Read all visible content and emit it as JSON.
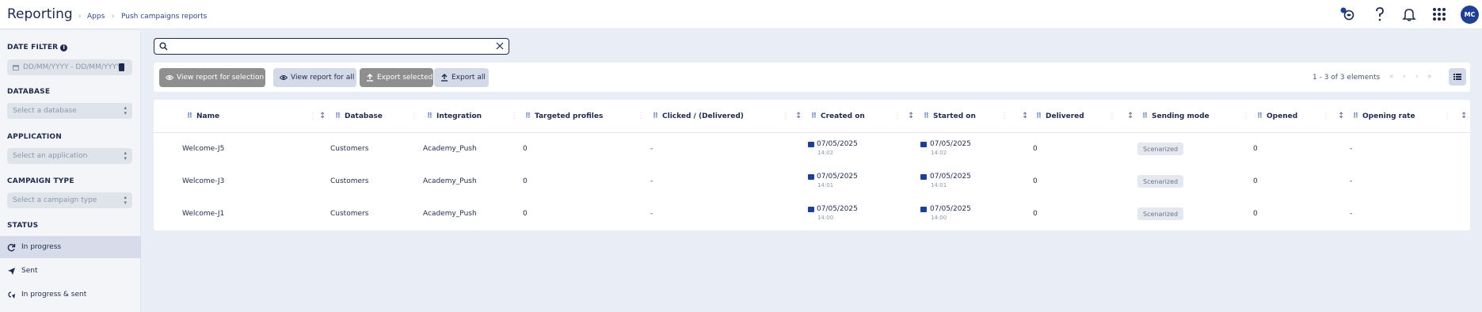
{
  "header": {
    "title": "Reporting",
    "breadcrumbs": [
      "Apps",
      "Push campaigns reports"
    ],
    "avatar_initials": "MC",
    "icons": [
      "notification-toggle-icon",
      "help-icon",
      "bell-icon",
      "apps-grid-icon"
    ]
  },
  "sidebar": {
    "date_filter_title": "DATE FILTER",
    "date_placeholder": "DD/MM/YYYY - DD/MM/YYYY",
    "database_title": "DATABASE",
    "database_placeholder": "Select a database",
    "application_title": "APPLICATION",
    "application_placeholder": "Select an application",
    "campaign_type_title": "CAMPAIGN TYPE",
    "campaign_type_placeholder": "Select a campaign type",
    "status_title": "STATUS",
    "status_items": [
      {
        "label": "In progress",
        "icon": "refresh-icon",
        "active": true
      },
      {
        "label": "Sent",
        "icon": "send-icon",
        "active": false
      },
      {
        "label": "In progress & sent",
        "icon": "progress-sent-icon",
        "active": false
      }
    ]
  },
  "search": {
    "value": ""
  },
  "toolbar": {
    "view_selection": "View report for selection",
    "view_all": "View report for all",
    "export_selected": "Export selected",
    "export_all": "Export all"
  },
  "pager": {
    "count_text": "1 - 3 of 3 elements"
  },
  "table": {
    "columns": [
      "Name",
      "Database",
      "Integration",
      "Targeted profiles",
      "Clicked / (Delivered)",
      "Created on",
      "Started on",
      "Delivered",
      "Sending mode",
      "Opened",
      "Opening rate"
    ],
    "rows": [
      {
        "name": "Welcome-J5",
        "database": "Customers",
        "integration": "Academy_Push",
        "targeted": "0",
        "clicked": "-",
        "created_date": "07/05/2025",
        "created_time": "14:02",
        "started_date": "07/05/2025",
        "started_time": "14:02",
        "delivered": "0",
        "mode": "Scenarized",
        "opened": "0",
        "rate": "-"
      },
      {
        "name": "Welcome-J3",
        "database": "Customers",
        "integration": "Academy_Push",
        "targeted": "0",
        "clicked": "-",
        "created_date": "07/05/2025",
        "created_time": "14:01",
        "started_date": "07/05/2025",
        "started_time": "14:01",
        "delivered": "0",
        "mode": "Scenarized",
        "opened": "0",
        "rate": "-"
      },
      {
        "name": "Welcome-J1",
        "database": "Customers",
        "integration": "Academy_Push",
        "targeted": "0",
        "clicked": "-",
        "created_date": "07/05/2025",
        "created_time": "14:00",
        "started_date": "07/05/2025",
        "started_time": "14:00",
        "delivered": "0",
        "mode": "Scenarized",
        "opened": "0",
        "rate": "-"
      }
    ]
  },
  "colors": {
    "primary": "#1e3f94",
    "text": "#1f2b4d",
    "background": "#e9edf5",
    "button_dark": "#8f8f8f",
    "button_light": "#d3d9e6"
  }
}
